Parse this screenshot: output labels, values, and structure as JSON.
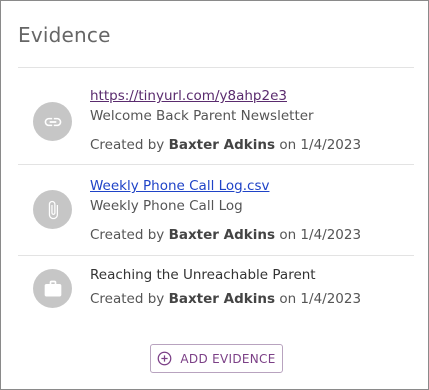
{
  "panel": {
    "title": "Evidence"
  },
  "items": [
    {
      "icon": "link-icon",
      "link": "https://tinyurl.com/y8ahp2e3",
      "description": "Welcome Back Parent Newsletter",
      "created_prefix": "Created by",
      "author": "Baxter Adkins",
      "date_text": "on 1/4/2023"
    },
    {
      "icon": "paperclip-icon",
      "link": "Weekly Phone Call Log.csv",
      "description": "Weekly Phone Call Log",
      "created_prefix": "Created by",
      "author": "Baxter Adkins",
      "date_text": "on 1/4/2023"
    },
    {
      "icon": "briefcase-icon",
      "title": "Reaching the Unreachable Parent",
      "created_prefix": "Created by",
      "author": "Baxter Adkins",
      "date_text": "on 1/4/2023"
    }
  ],
  "add_button": {
    "label": "ADD EVIDENCE",
    "icon": "plus-circle-icon"
  },
  "colors": {
    "icon_circle": "#c6c6c6",
    "visited_link": "#5a2b6e",
    "link": "#1f43c7",
    "button_accent": "#7b3f86"
  }
}
